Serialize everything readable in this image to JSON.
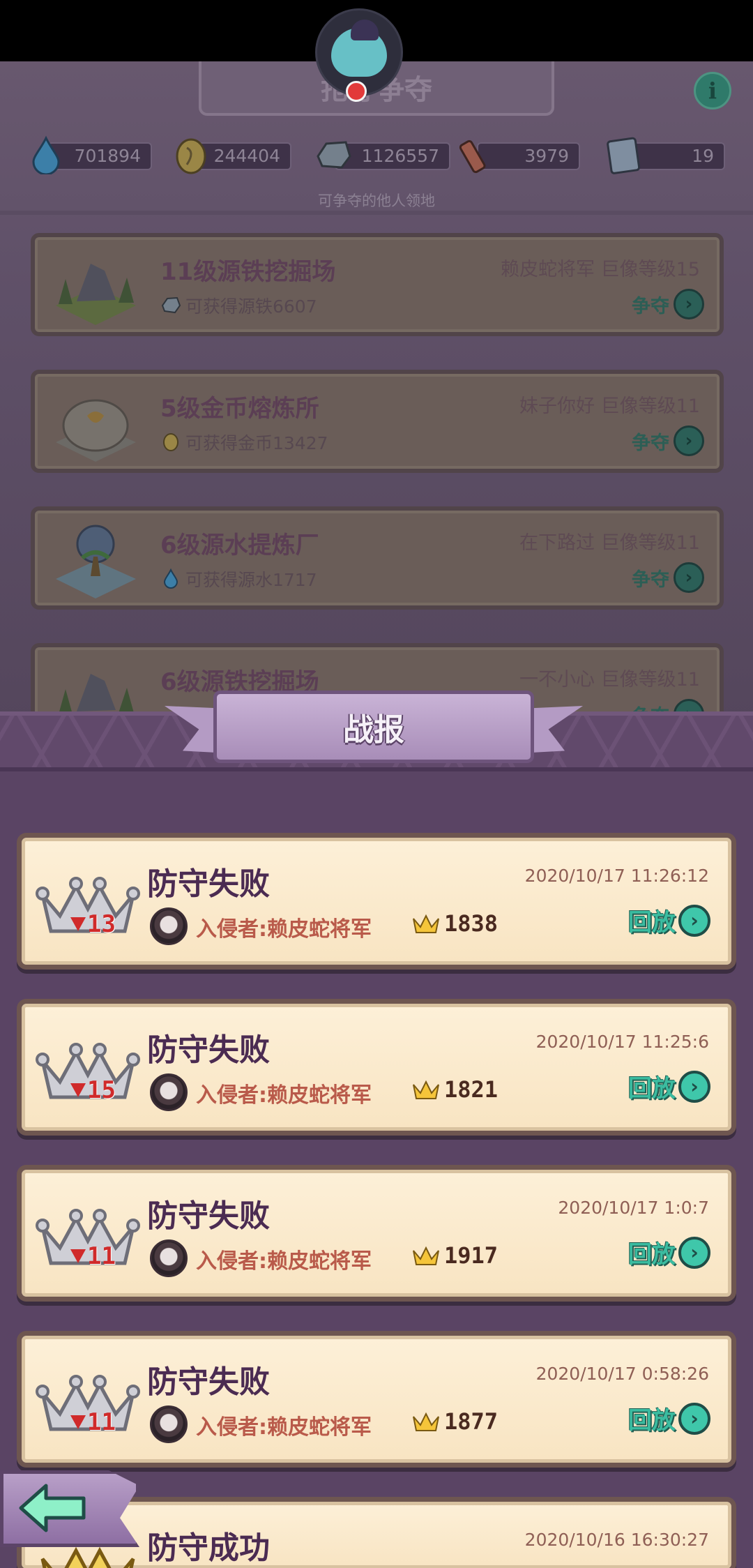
{
  "background": {
    "title": "抢夺争夺",
    "resources": [
      {
        "name": "water",
        "icon": "water-drop-icon",
        "value": "701894"
      },
      {
        "name": "gold",
        "icon": "gold-coin-icon",
        "value": "244404"
      },
      {
        "name": "iron",
        "icon": "iron-ore-icon",
        "value": "1126557"
      },
      {
        "name": "scroll",
        "icon": "scroll-icon",
        "value": "3979"
      },
      {
        "name": "score",
        "icon": "score-card-icon",
        "value": "19"
      }
    ],
    "subtitle": "可争夺的他人领地",
    "territories": [
      {
        "name": "11级源铁挖掘场",
        "reward": "可获得源铁6607",
        "reward_icon": "iron-ore-icon",
        "owner": "赖皮蛇将军  巨像等级15",
        "action": "争夺"
      },
      {
        "name": "5级金币熔炼所",
        "reward": "可获得金币13427",
        "reward_icon": "gold-coin-icon",
        "owner": "妹子你好  巨像等级11",
        "action": "争夺"
      },
      {
        "name": "6级源水提炼厂",
        "reward": "可获得源水1717",
        "reward_icon": "water-drop-icon",
        "owner": "在下路过  巨像等级11",
        "action": "争夺"
      },
      {
        "name": "6级源铁挖掘场",
        "reward": "",
        "reward_icon": "iron-ore-icon",
        "owner": "一不小心  巨像等级11",
        "action": "争夺"
      }
    ]
  },
  "report": {
    "title": "战报",
    "entries": [
      {
        "result": "防守失败",
        "timestamp": "2020/10/17 11:26:12",
        "rank_change": "13",
        "invader": "入侵者:赖皮蛇将军",
        "trophies": "1838",
        "replay_label": "回放"
      },
      {
        "result": "防守失败",
        "timestamp": "2020/10/17 11:25:6",
        "rank_change": "15",
        "invader": "入侵者:赖皮蛇将军",
        "trophies": "1821",
        "replay_label": "回放"
      },
      {
        "result": "防守失败",
        "timestamp": "2020/10/17 1:0:7",
        "rank_change": "11",
        "invader": "入侵者:赖皮蛇将军",
        "trophies": "1917",
        "replay_label": "回放"
      },
      {
        "result": "防守失败",
        "timestamp": "2020/10/17 0:58:26",
        "rank_change": "11",
        "invader": "入侵者:赖皮蛇将军",
        "trophies": "1877",
        "replay_label": "回放"
      },
      {
        "result": "防守成功",
        "timestamp": "2020/10/16 16:30:27",
        "rank_change": "",
        "invader": "",
        "trophies": "",
        "replay_label": ""
      }
    ]
  },
  "icons": {
    "info": "i",
    "go": "›"
  },
  "colors": {
    "accent_teal": "#3fc7aa",
    "loss_red": "#d02a2a",
    "panel_purple": "#5a4464",
    "card_cream": "#fdf0d8"
  }
}
